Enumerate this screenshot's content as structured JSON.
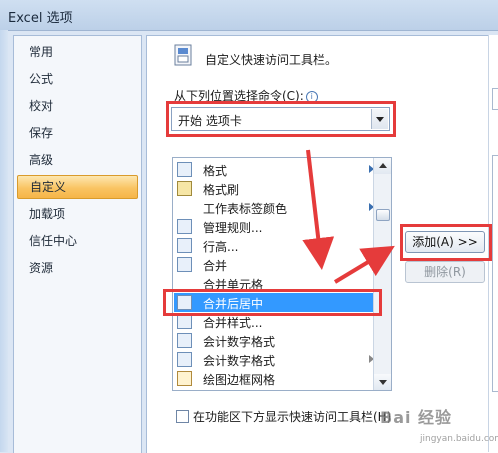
{
  "window": {
    "title": "Excel 选项"
  },
  "sidebar": {
    "items": [
      {
        "label": "常用",
        "active": false
      },
      {
        "label": "公式",
        "active": false
      },
      {
        "label": "校对",
        "active": false
      },
      {
        "label": "保存",
        "active": false
      },
      {
        "label": "高级",
        "active": false
      },
      {
        "label": "自定义",
        "active": true
      },
      {
        "label": "加载项",
        "active": false
      },
      {
        "label": "信任中心",
        "active": false
      },
      {
        "label": "资源",
        "active": false
      }
    ]
  },
  "main": {
    "header": "自定义快速访问工具栏。",
    "choose_label": "从下列位置选择命令(C):",
    "dropdown_value": "开始 选项卡",
    "commands": [
      {
        "label": "格式",
        "icon": "format-icon",
        "submenu": true,
        "selected": false
      },
      {
        "label": "格式刷",
        "icon": "format-painter-icon",
        "submenu": false,
        "selected": false
      },
      {
        "label": "工作表标签颜色",
        "icon": "tab-color-icon",
        "submenu": true,
        "selected": false
      },
      {
        "label": "管理规则...",
        "icon": "manage-rules-icon",
        "submenu": false,
        "selected": false
      },
      {
        "label": "行高...",
        "icon": "row-height-icon",
        "submenu": false,
        "selected": false
      },
      {
        "label": "合并",
        "icon": "merge-icon",
        "submenu": false,
        "selected": false
      },
      {
        "label": "合并单元格",
        "icon": "merge-cells-icon",
        "submenu": false,
        "selected": false
      },
      {
        "label": "合并后居中",
        "icon": "merge-center-icon",
        "submenu": false,
        "selected": true
      },
      {
        "label": "合并样式...",
        "icon": "merge-styles-icon",
        "submenu": false,
        "selected": false
      },
      {
        "label": "会计数字格式",
        "icon": "accounting-format-icon",
        "submenu": false,
        "selected": false
      },
      {
        "label": "会计数字格式",
        "icon": "accounting-format-icon",
        "submenu": true,
        "selected": false
      },
      {
        "label": "绘图边框网格",
        "icon": "draw-border-grid-icon",
        "submenu": false,
        "selected": false
      }
    ],
    "add_button": "添加(A) >>",
    "remove_button": "删除(R)",
    "checkbox_label": "在功能区下方显示快速访问工具栏(H)"
  },
  "watermark": {
    "text": "Bai 经验",
    "url": "jingyan.baidu.com"
  },
  "colors": {
    "highlight": "#3399ff",
    "annotation": "#e53b3b",
    "active_nav": "#f9c463"
  }
}
